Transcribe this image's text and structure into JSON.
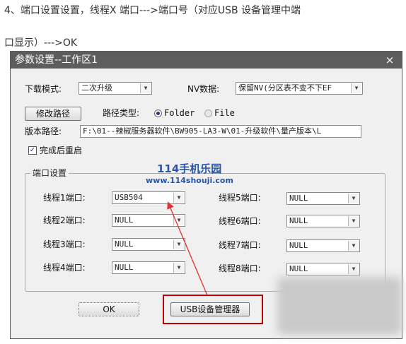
{
  "article": {
    "line1": "4、端口设置设置，线程X 端口--->端口号（对应USB 设备管理中端",
    "line2": "口显示）--->OK"
  },
  "dialog": {
    "title": "参数设置--工作区1",
    "close_label": "×",
    "download_mode": {
      "label": "下载模式:",
      "value": "二次升级"
    },
    "nv_data": {
      "label": "NV数据:",
      "value": "保留NV(分区表不变不下EF"
    },
    "modify_path_button": "修改路径",
    "path_type": {
      "label": "路径类型:",
      "option_folder": "Folder",
      "option_file": "File",
      "selected": "Folder"
    },
    "version_path": {
      "label": "版本路径:",
      "value": "F:\\01--辣椒服务器软件\\BW905-LA3-W\\01-升级软件\\量产版本\\L"
    },
    "restart_after": {
      "label": "完成后重启",
      "checked": true,
      "mark": "✓"
    },
    "port_settings": {
      "title": "端口设置",
      "left": [
        {
          "label": "线程1端口:",
          "value": "USB504"
        },
        {
          "label": "线程2端口:",
          "value": "NULL"
        },
        {
          "label": "线程3端口:",
          "value": "NULL"
        },
        {
          "label": "线程4端口:",
          "value": "NULL"
        }
      ],
      "right": [
        {
          "label": "线程5端口:",
          "value": "NULL"
        },
        {
          "label": "线程6端口:",
          "value": "NULL"
        },
        {
          "label": "线程7端口:",
          "value": "NULL"
        },
        {
          "label": "线程8端口:",
          "value": "NULL"
        }
      ]
    },
    "ok_button": "OK",
    "usb_manager_button": "USB设备管理器"
  },
  "watermark": {
    "line1": "114手机乐园",
    "line2": "www.114shouji.com"
  },
  "colors": {
    "titlebar": "#5d5d5d",
    "annotation": "#c00000",
    "watermark": "#2b55a5"
  }
}
